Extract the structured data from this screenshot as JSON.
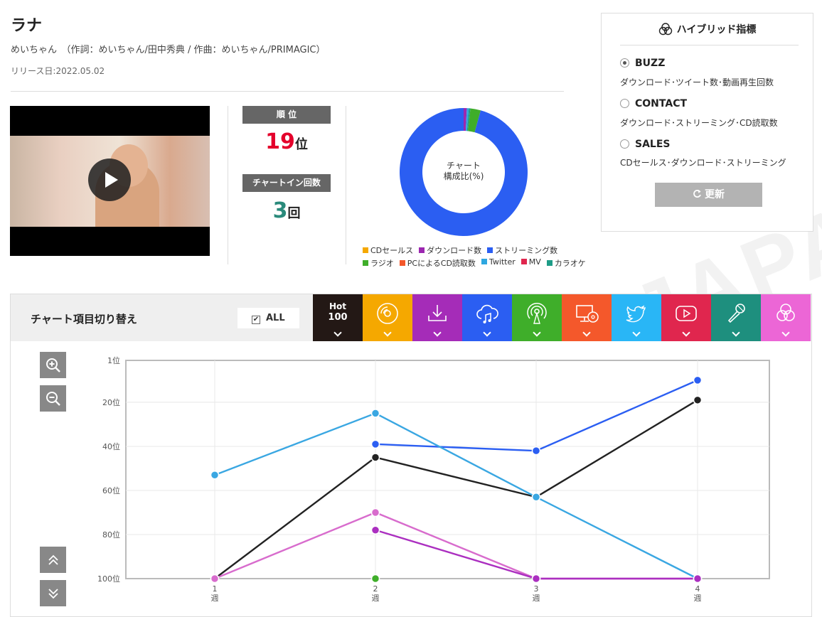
{
  "song": {
    "title": "ラナ",
    "credits": "めいちゃん　（作詞：めいちゃん/田中秀典 / 作曲：めいちゃん/PRIMAGIC）",
    "release": "リリース日:2022.05.02"
  },
  "rank": {
    "label": "順 位",
    "value": "19",
    "unit": "位",
    "value_color": "#e4002b"
  },
  "chart_in": {
    "label": "チャートイン回数",
    "value": "3",
    "unit": "回",
    "value_color": "#2a8a7b"
  },
  "composition": {
    "center_line1": "チャート",
    "center_line2": "構成比(%)",
    "slices": [
      {
        "name": "CDセールス",
        "color": "#f5a800",
        "value": 0
      },
      {
        "name": "ダウンロード数",
        "color": "#9c27b0",
        "value": 0.8
      },
      {
        "name": "ストリーミング数",
        "color": "#2b5ef2",
        "value": 95.7
      },
      {
        "name": "ラジオ",
        "color": "#3fae2a",
        "value": 2.6
      },
      {
        "name": "PCによるCD読取数",
        "color": "#f4582b",
        "value": 0
      },
      {
        "name": "Twitter",
        "color": "#2ea7e0",
        "value": 0.5
      },
      {
        "name": "MV",
        "color": "#e0264e",
        "value": 0
      },
      {
        "name": "カラオケ",
        "color": "#1e9c87",
        "value": 0.4
      }
    ]
  },
  "hybrid": {
    "title": "ハイブリッド指標",
    "options": [
      {
        "label": "BUZZ",
        "desc": "ダウンロード･ツイート数･動画再生回数",
        "selected": true
      },
      {
        "label": "CONTACT",
        "desc": "ダウンロード･ストリーミング･CD読取数",
        "selected": false
      },
      {
        "label": "SALES",
        "desc": "CDセールス･ダウンロード･ストリーミング",
        "selected": false
      }
    ],
    "update_label": "更新"
  },
  "switcher": {
    "title": "チャート項目切り替え",
    "all_label": "ALL",
    "hot_label_1": "Hot",
    "hot_label_2": "100",
    "tabs": [
      {
        "icon": "hot100",
        "color": "#231815"
      },
      {
        "icon": "cd-icon",
        "color": "#f5a800"
      },
      {
        "icon": "download-icon",
        "color": "#a52cb8"
      },
      {
        "icon": "streaming-icon",
        "color": "#2b5ef2"
      },
      {
        "icon": "radio-icon",
        "color": "#3fae2a"
      },
      {
        "icon": "pc-cd-icon",
        "color": "#f4582b"
      },
      {
        "icon": "twitter-icon",
        "color": "#29b6f6"
      },
      {
        "icon": "mv-icon",
        "color": "#e0264e"
      },
      {
        "icon": "karaoke-icon",
        "color": "#1e8f7e"
      },
      {
        "icon": "hybrid-icon",
        "color": "#ec66d6"
      }
    ]
  },
  "watermark": "JAPAN",
  "chart_data": {
    "type": "line",
    "x": [
      1,
      2,
      3,
      4
    ],
    "x_tick_labels": [
      [
        "1",
        "週"
      ],
      [
        "2",
        "週"
      ],
      [
        "3",
        "週"
      ],
      [
        "4",
        "週"
      ]
    ],
    "y_ticks": [
      1,
      20,
      40,
      60,
      80,
      100
    ],
    "y_tick_labels": [
      "1位",
      "20位",
      "40位",
      "60位",
      "80位",
      "100位"
    ],
    "ylim": [
      1,
      100
    ],
    "y_inverted": true,
    "grid": true,
    "series": [
      {
        "color": "#222222",
        "values": [
          100,
          45,
          63,
          19
        ]
      },
      {
        "color": "#2b5ef2",
        "values": [
          null,
          39,
          42,
          10
        ]
      },
      {
        "color": "#3aa7e2",
        "values": [
          53,
          25,
          63,
          100
        ]
      },
      {
        "color": "#d86ccd",
        "values": [
          100,
          70,
          100,
          100
        ]
      },
      {
        "color": "#ab2fc0",
        "values": [
          null,
          78,
          100,
          100
        ]
      },
      {
        "color": "#3fae2a",
        "values": [
          null,
          100,
          null,
          null
        ]
      }
    ]
  }
}
